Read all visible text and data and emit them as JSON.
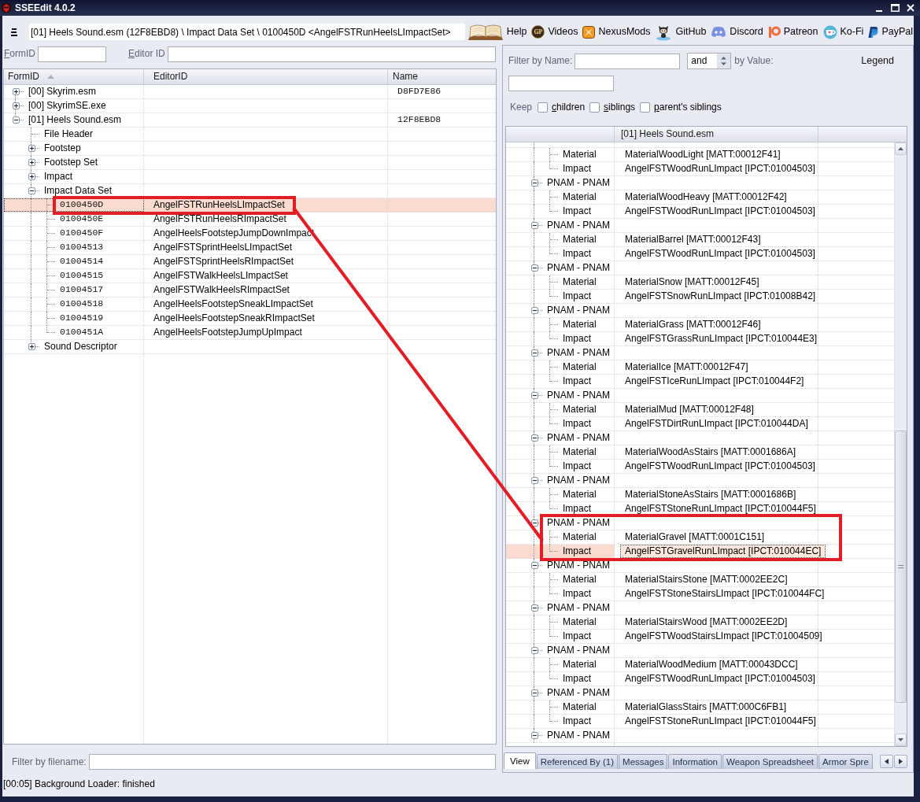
{
  "window": {
    "title": "SSEEdit 4.0.2"
  },
  "toolbar": {
    "path": "[01] Heels Sound.esm (12F8EBD8) \\ Impact Data Set \\ 0100450D <AngelFSTRunHeelsLImpactSet>",
    "links": [
      {
        "label": "Help"
      },
      {
        "label": "Videos",
        "emblem": "GP"
      },
      {
        "label": "NexusMods"
      },
      {
        "label": "GitHub"
      },
      {
        "label": "Discord"
      },
      {
        "label": "Patreon"
      },
      {
        "label": "Ko-Fi"
      },
      {
        "label": "PayPal"
      }
    ]
  },
  "left_panel": {
    "filters": [
      {
        "label": "FormID"
      },
      {
        "label": "Editor ID"
      }
    ],
    "tree": {
      "columns": [
        {
          "label": "FormID",
          "sorted": true
        },
        {
          "label": "EditorID",
          "sorted": false
        },
        {
          "label": "Name",
          "sorted": false
        }
      ],
      "nodes": [
        {
          "kind": "file",
          "label": "[00] Skyrim.esm",
          "name": "D8FD7E86",
          "expanded": false,
          "selected": false
        },
        {
          "kind": "file",
          "label": "[00] SkyrimSE.exe",
          "expanded": false,
          "selected": false
        },
        {
          "kind": "file",
          "label": "[01] Heels Sound.esm",
          "name": "12F8EBD8",
          "expanded": true,
          "selected": false,
          "children": [
            {
              "kind": "header",
              "label": "File Header",
              "selected": false
            },
            {
              "kind": "group",
              "label": "Footstep",
              "expanded": false,
              "selected": false
            },
            {
              "kind": "group",
              "label": "Footstep Set",
              "expanded": false,
              "selected": false
            },
            {
              "kind": "group",
              "label": "Impact",
              "expanded": false,
              "selected": false
            },
            {
              "kind": "group",
              "label": "Impact Data Set",
              "expanded": true,
              "selected": false,
              "children": [
                {
                  "kind": "record",
                  "form_id": "0100450D",
                  "editor_id": "AngelFSTRunHeelsLImpactSet",
                  "selected": true,
                  "highlighted": true
                },
                {
                  "kind": "record",
                  "form_id": "0100450E",
                  "editor_id": "AngelFSTRunHeelsRImpactSet",
                  "selected": false,
                  "highlighted": false
                },
                {
                  "kind": "record",
                  "form_id": "0100450F",
                  "editor_id": "AngelHeelsFootstepJumpDownImpact",
                  "selected": false,
                  "highlighted": false
                },
                {
                  "kind": "record",
                  "form_id": "01004513",
                  "editor_id": "AngelFSTSprintHeelsLImpactSet",
                  "selected": false,
                  "highlighted": false
                },
                {
                  "kind": "record",
                  "form_id": "01004514",
                  "editor_id": "AngelFSTSprintHeelsRImpactSet",
                  "selected": false,
                  "highlighted": false
                },
                {
                  "kind": "record",
                  "form_id": "01004515",
                  "editor_id": "AngelFSTWalkHeelsLImpactSet",
                  "selected": false,
                  "highlighted": false
                },
                {
                  "kind": "record",
                  "form_id": "01004517",
                  "editor_id": "AngelFSTWalkHeelsRImpactSet",
                  "selected": false,
                  "highlighted": false
                },
                {
                  "kind": "record",
                  "form_id": "01004518",
                  "editor_id": "AngelHeelsFootstepSneakLImpactSet",
                  "selected": false,
                  "highlighted": false
                },
                {
                  "kind": "record",
                  "form_id": "01004519",
                  "editor_id": "AngelHeelsFootstepSneakRImpactSet",
                  "selected": false,
                  "highlighted": false
                },
                {
                  "kind": "record",
                  "form_id": "0100451A",
                  "editor_id": "AngelHeelsFootstepJumpUpImpact",
                  "selected": false,
                  "highlighted": false
                }
              ]
            },
            {
              "kind": "group",
              "label": "Sound Descriptor",
              "expanded": false,
              "selected": false
            }
          ]
        }
      ]
    },
    "filename_filter": {
      "label": "Filter by filename:"
    }
  },
  "right_panel": {
    "filter": {
      "name_label": "Filter by Name:",
      "operator": "and",
      "value_label": "by Value:",
      "legend": "Legend",
      "keep_label": "Keep",
      "keep_options": [
        {
          "label": "children",
          "checked": false
        },
        {
          "label": "siblings",
          "checked": false
        },
        {
          "label": "parent's siblings",
          "checked": false
        }
      ]
    },
    "record_view": {
      "file_column": "[01] Heels Sound.esm",
      "groups": [
        {
          "expanded": true,
          "highlighted": false,
          "fields": [
            {
              "label": "Material",
              "value": "MaterialWoodLight [MATT:00012F41]",
              "selected": false
            },
            {
              "label": "Impact",
              "value": "AngelFSTWoodRunLImpact [IPCT:01004503]",
              "selected": false
            }
          ]
        },
        {
          "label": "PNAM - PNAM",
          "expanded": true,
          "selected": false,
          "highlighted": false,
          "fields": [
            {
              "label": "Material",
              "value": "MaterialWoodHeavy [MATT:00012F42]",
              "selected": false
            },
            {
              "label": "Impact",
              "value": "AngelFSTWoodRunLImpact [IPCT:01004503]",
              "selected": false
            }
          ]
        },
        {
          "label": "PNAM - PNAM",
          "expanded": true,
          "selected": false,
          "highlighted": false,
          "fields": [
            {
              "label": "Material",
              "value": "MaterialBarrel [MATT:00012F43]",
              "selected": false
            },
            {
              "label": "Impact",
              "value": "AngelFSTWoodRunLImpact [IPCT:01004503]",
              "selected": false
            }
          ]
        },
        {
          "label": "PNAM - PNAM",
          "expanded": true,
          "selected": false,
          "highlighted": false,
          "fields": [
            {
              "label": "Material",
              "value": "MaterialSnow [MATT:00012F45]",
              "selected": false
            },
            {
              "label": "Impact",
              "value": "AngelFSTSnowRunLImpact [IPCT:01008B42]",
              "selected": false
            }
          ]
        },
        {
          "label": "PNAM - PNAM",
          "expanded": true,
          "selected": false,
          "highlighted": false,
          "fields": [
            {
              "label": "Material",
              "value": "MaterialGrass [MATT:00012F46]",
              "selected": false
            },
            {
              "label": "Impact",
              "value": "AngelFSTGrassRunLImpact [IPCT:010044E3]",
              "selected": false
            }
          ]
        },
        {
          "label": "PNAM - PNAM",
          "expanded": true,
          "selected": false,
          "highlighted": false,
          "fields": [
            {
              "label": "Material",
              "value": "MaterialIce [MATT:00012F47]",
              "selected": false
            },
            {
              "label": "Impact",
              "value": "AngelFSTIceRunLImpact [IPCT:010044F2]",
              "selected": false
            }
          ]
        },
        {
          "label": "PNAM - PNAM",
          "expanded": true,
          "selected": false,
          "highlighted": false,
          "fields": [
            {
              "label": "Material",
              "value": "MaterialMud [MATT:00012F48]",
              "selected": false
            },
            {
              "label": "Impact",
              "value": "AngelFSTDirtRunLImpact [IPCT:010044DA]",
              "selected": false
            }
          ]
        },
        {
          "label": "PNAM - PNAM",
          "expanded": true,
          "selected": false,
          "highlighted": false,
          "fields": [
            {
              "label": "Material",
              "value": "MaterialWoodAsStairs [MATT:0001686A]",
              "selected": false
            },
            {
              "label": "Impact",
              "value": "AngelFSTWoodRunLImpact [IPCT:01004503]",
              "selected": false
            }
          ]
        },
        {
          "label": "PNAM - PNAM",
          "expanded": true,
          "selected": false,
          "highlighted": false,
          "fields": [
            {
              "label": "Material",
              "value": "MaterialStoneAsStairs [MATT:0001686B]",
              "selected": false
            },
            {
              "label": "Impact",
              "value": "AngelFSTStoneRunLImpact [IPCT:010044F5]",
              "selected": false
            }
          ]
        },
        {
          "label": "PNAM - PNAM",
          "expanded": true,
          "selected": false,
          "highlighted": true,
          "fields": [
            {
              "label": "Material",
              "value": "MaterialGravel [MATT:0001C151]",
              "selected": false
            },
            {
              "label": "Impact",
              "value": "AngelFSTGravelRunLImpact [IPCT:010044EC]",
              "selected": true
            }
          ]
        },
        {
          "label": "PNAM - PNAM",
          "expanded": true,
          "selected": false,
          "highlighted": false,
          "fields": [
            {
              "label": "Material",
              "value": "MaterialStairsStone [MATT:0002EE2C]",
              "selected": false
            },
            {
              "label": "Impact",
              "value": "AngelFSTStoneStairsLImpact [IPCT:010044FC]",
              "selected": false
            }
          ]
        },
        {
          "label": "PNAM - PNAM",
          "expanded": true,
          "selected": false,
          "highlighted": false,
          "fields": [
            {
              "label": "Material",
              "value": "MaterialStairsWood [MATT:0002EE2D]",
              "selected": false
            },
            {
              "label": "Impact",
              "value": "AngelFSTWoodStairsLImpact [IPCT:01004509]",
              "selected": false
            }
          ]
        },
        {
          "label": "PNAM - PNAM",
          "expanded": true,
          "selected": false,
          "highlighted": false,
          "fields": [
            {
              "label": "Material",
              "value": "MaterialWoodMedium [MATT:00043DCC]",
              "selected": false
            },
            {
              "label": "Impact",
              "value": "AngelFSTWoodRunLImpact [IPCT:01004503]",
              "selected": false
            }
          ]
        },
        {
          "label": "PNAM - PNAM",
          "expanded": true,
          "selected": false,
          "highlighted": false,
          "fields": [
            {
              "label": "Material",
              "value": "MaterialGlassStairs [MATT:000C6FB1]",
              "selected": false
            },
            {
              "label": "Impact",
              "value": "AngelFSTStoneRunLImpact [IPCT:010044F5]",
              "selected": false
            }
          ]
        },
        {
          "label": "PNAM - PNAM",
          "expanded": true,
          "selected": false,
          "highlighted": false
        }
      ]
    },
    "tabs": [
      {
        "label": "View",
        "selected": true
      },
      {
        "label": "Referenced By (1)",
        "selected": false
      },
      {
        "label": "Messages",
        "selected": false
      },
      {
        "label": "Information",
        "selected": false
      },
      {
        "label": "Weapon Spreadsheet",
        "selected": false
      },
      {
        "label": "Armor Spre",
        "selected": false
      }
    ]
  },
  "status_bar": "[00:05] Background Loader: finished"
}
